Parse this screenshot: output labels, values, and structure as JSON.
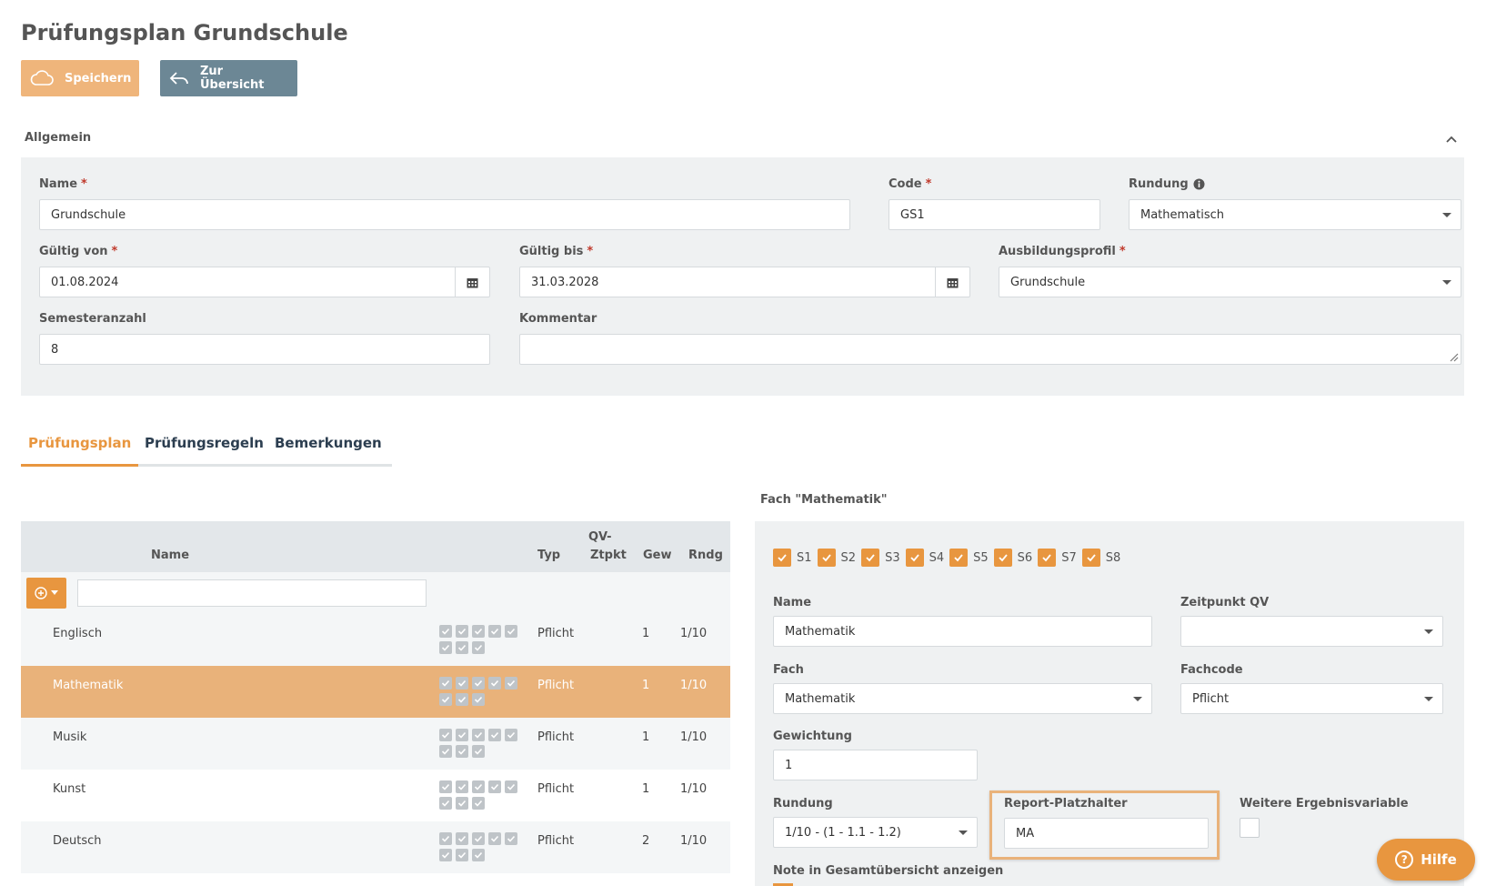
{
  "page": {
    "title": "Prüfungsplan Grundschule"
  },
  "toolbar": {
    "save_label": "Speichern",
    "back_label": "Zur Übersicht"
  },
  "general": {
    "section_label": "Allgemein",
    "name": {
      "label": "Name",
      "required": "*",
      "value": "Grundschule"
    },
    "code": {
      "label": "Code",
      "required": "*",
      "value": "GS1"
    },
    "rundung": {
      "label": "Rundung",
      "value": "Mathematisch"
    },
    "gueltig_von": {
      "label": "Gültig von",
      "required": "*",
      "value": "01.08.2024"
    },
    "gueltig_bis": {
      "label": "Gültig bis",
      "required": "*",
      "value": "31.03.2028"
    },
    "ausbildungsprofil": {
      "label": "Ausbildungsprofil",
      "required": "*",
      "value": "Grundschule"
    },
    "semesteranzahl": {
      "label": "Semesteranzahl",
      "value": "8"
    },
    "kommentar": {
      "label": "Kommentar",
      "value": ""
    }
  },
  "tabs": [
    {
      "label": "Prüfungsplan",
      "active": true
    },
    {
      "label": "Prüfungsregeln",
      "active": false
    },
    {
      "label": "Bemerkungen",
      "active": false
    }
  ],
  "table": {
    "headers": {
      "name": "Name",
      "typ": "Typ",
      "qv": "QV-",
      "qv2": "Ztpkt",
      "gew": "Gew",
      "rndg": "Rndg"
    },
    "rows": [
      {
        "name": "Englisch",
        "typ": "Pflicht",
        "gew": "1",
        "rndg": "1/10"
      },
      {
        "name": "Mathematik",
        "typ": "Pflicht",
        "gew": "1",
        "rndg": "1/10"
      },
      {
        "name": "Musik",
        "typ": "Pflicht",
        "gew": "1",
        "rndg": "1/10"
      },
      {
        "name": "Kunst",
        "typ": "Pflicht",
        "gew": "1",
        "rndg": "1/10"
      },
      {
        "name": "Deutsch",
        "typ": "Pflicht",
        "gew": "2",
        "rndg": "1/10"
      }
    ]
  },
  "detail": {
    "title": "Fach \"Mathematik\"",
    "semesters": [
      "S1",
      "S2",
      "S3",
      "S4",
      "S5",
      "S6",
      "S7",
      "S8"
    ],
    "name": {
      "label": "Name",
      "value": "Mathematik"
    },
    "zeitpunkt_qv": {
      "label": "Zeitpunkt QV",
      "value": ""
    },
    "fach": {
      "label": "Fach",
      "value": "Mathematik"
    },
    "fachcode": {
      "label": "Fachcode",
      "value": "Pflicht"
    },
    "gewichtung": {
      "label": "Gewichtung",
      "value": "1"
    },
    "rundung": {
      "label": "Rundung",
      "value": "1/10 - (1 - 1.1 - 1.2)"
    },
    "report_platzhalter": {
      "label": "Report-Platzhalter",
      "value": "MA"
    },
    "weitere": {
      "label": "Weitere Ergebnisvariable"
    },
    "note_label": "Note in Gesamtübersicht anzeigen"
  },
  "help": {
    "label": "Hilfe",
    "glyph": "?"
  }
}
